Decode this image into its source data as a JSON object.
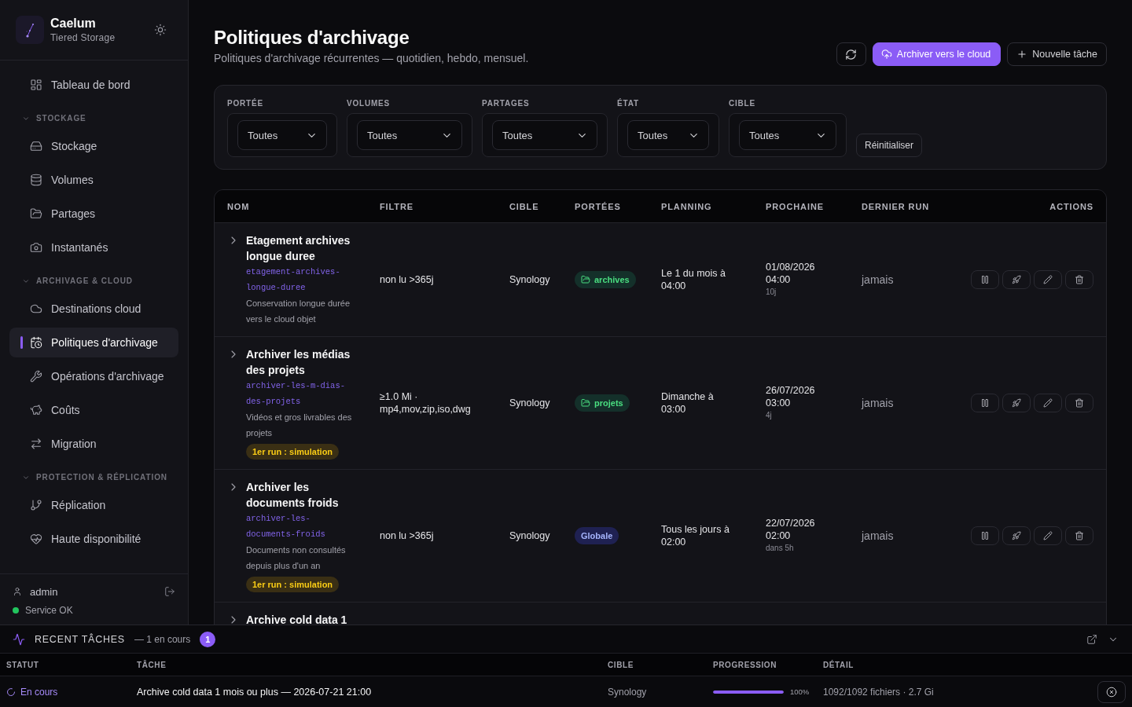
{
  "sidebar": {
    "brand": {
      "name": "Caelum",
      "tagline": "Tiered Storage"
    },
    "nav": [
      {
        "kind": "link",
        "label": "Tableau de bord",
        "selected": false
      },
      {
        "kind": "section",
        "label": "STOCKAGE",
        "expanded": true,
        "children": [
          {
            "label": "Stockage",
            "selected": false
          },
          {
            "label": "Volumes",
            "selected": false
          },
          {
            "label": "Partages",
            "selected": false
          },
          {
            "label": "Instantanés",
            "selected": false
          }
        ]
      },
      {
        "kind": "section",
        "label": "ARCHIVAGE & CLOUD",
        "expanded": true,
        "children": [
          {
            "label": "Destinations cloud",
            "selected": false
          },
          {
            "label": "Politiques d'archivage",
            "selected": true
          },
          {
            "label": "Opérations d'archivage",
            "selected": false
          },
          {
            "label": "Coûts",
            "selected": false
          },
          {
            "label": "Migration",
            "selected": false
          }
        ]
      },
      {
        "kind": "section",
        "label": "PROTECTION & RÉPLICATION",
        "expanded": true,
        "children": [
          {
            "label": "Réplication",
            "selected": false
          },
          {
            "label": "Haute disponibilité",
            "selected": false
          }
        ]
      }
    ],
    "footer": {
      "user": "admin",
      "service": {
        "kind": "ok",
        "label": "Service OK"
      }
    }
  },
  "page": {
    "title": "Politiques d'archivage",
    "subtitle": "Politiques d'archivage récurrentes — quotidien, hebdo, mensuel.",
    "actions": [
      {
        "kind": "icon"
      },
      {
        "kind": "primary",
        "label": "Archiver vers le cloud"
      },
      {
        "kind": "outline",
        "label": "Nouvelle tâche"
      }
    ]
  },
  "filters": {
    "fields": [
      {
        "label": "PORTÉE",
        "value": "Toutes"
      },
      {
        "label": "VOLUMES",
        "value": "Toutes"
      },
      {
        "label": "PARTAGES",
        "value": "Toutes"
      },
      {
        "label": "ÉTAT",
        "value": "Toutes"
      },
      {
        "label": "CIBLE",
        "value": "Toutes"
      }
    ],
    "reset": "Réinitialiser"
  },
  "table": {
    "columns": [
      "NOM",
      "FILTRE",
      "CIBLE",
      "PORTÉES",
      "PLANNING",
      "PROCHAINE",
      "DERNIER RUN",
      "ACTIONS"
    ],
    "rows": [
      {
        "expanded": false,
        "name": "Etagement archives longue duree",
        "slug": "etagement-archives-longue-duree",
        "description": "Conservation longue durée vers le cloud objet",
        "filter": "non lu >365j",
        "target": "Synology",
        "scope": {
          "kind": "share",
          "label": "archives"
        },
        "schedule": "Le 1 du mois à 04:00",
        "next": {
          "date": "01/08/2026 04:00",
          "relative": "10j"
        },
        "last_run": "jamais"
      },
      {
        "expanded": false,
        "name": "Archiver les médias des projets",
        "slug": "archiver-les-m-dias-des-projets",
        "description": "Vidéos et gros livrables des projets",
        "badge": "1er run : simulation",
        "filter": "≥1.0 Mi · mp4,mov,zip,iso,dwg",
        "target": "Synology",
        "scope": {
          "kind": "share",
          "label": "projets"
        },
        "schedule": "Dimanche à 03:00",
        "next": {
          "date": "26/07/2026 03:00",
          "relative": "4j"
        },
        "last_run": "jamais"
      },
      {
        "expanded": false,
        "name": "Archiver les documents froids",
        "slug": "archiver-les-documents-froids",
        "description": "Documents non consultés depuis plus d'un an",
        "badge": "1er run : simulation",
        "filter": "non lu >365j",
        "target": "Synology",
        "scope": {
          "kind": "global",
          "label": "Globale"
        },
        "schedule": "Tous les jours à 02:00",
        "next": {
          "date": "22/07/2026 02:00",
          "relative": "dans 5h"
        },
        "last_run": "jamais"
      },
      {
        "expanded": false,
        "name": "Archive cold data 1"
      }
    ]
  },
  "tasks": {
    "title": "RECENT TÂCHES",
    "summary": "— 1 en cours",
    "count": "1",
    "columns": [
      "STATUT",
      "TÂCHE",
      "CIBLE",
      "PROGRESSION",
      "DÉTAIL"
    ],
    "rows": [
      {
        "status": {
          "kind": "running",
          "label": "En cours"
        },
        "task": "Archive cold data 1 mois ou plus — 2026-07-21 21:00",
        "target": "Synology",
        "level": 1,
        "percent": "100%",
        "detail": "1092/1092 fichiers · 2.7 Gi"
      }
    ]
  }
}
